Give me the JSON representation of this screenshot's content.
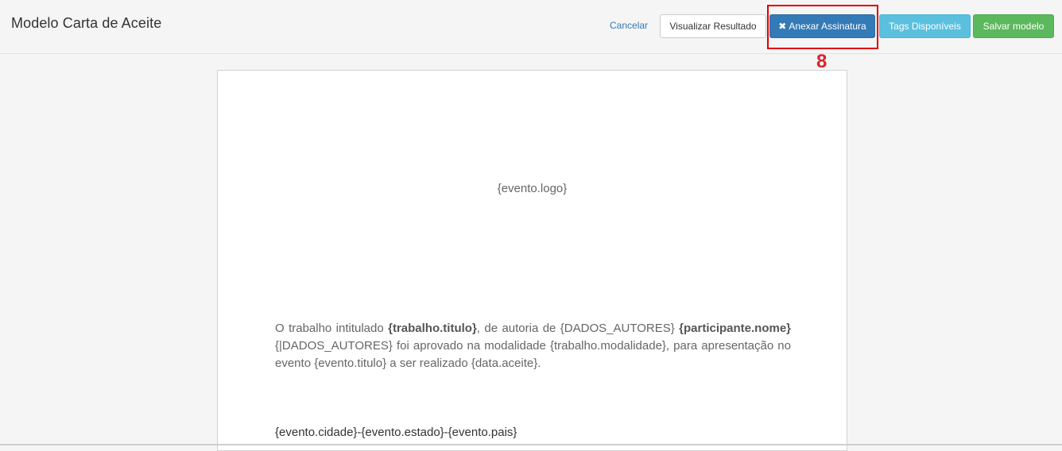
{
  "header": {
    "title": "Modelo Carta de Aceite",
    "cancel_label": "Cancelar",
    "buttons": {
      "preview": "Visualizar Resultado",
      "attach_signature": "Anexar Assinatura",
      "attach_icon": "✖",
      "tags": "Tags Disponíveis",
      "save": "Salvar modelo"
    }
  },
  "annotation": {
    "step": "8"
  },
  "document": {
    "logo_tag": "{evento.logo}",
    "paragraph": {
      "p1": "O trabalho intitulado ",
      "bold1": "{trabalho.titulo}",
      "p2": ", de autoria de {DADOS_AUTORES} ",
      "bold2": "{participante.nome}",
      "p3": " {|DADOS_AUTORES} foi aprovado na modalidade {trabalho.modalidade}, para apresentação no evento {evento.titulo} a ser realizado {data.aceite}."
    },
    "location_line": "{evento.cidade}-{evento.estado}-{evento.pais}"
  },
  "colors": {
    "primary": "#337ab7",
    "info": "#5bc0de",
    "success": "#5cb85c",
    "highlight": "#e00000"
  }
}
